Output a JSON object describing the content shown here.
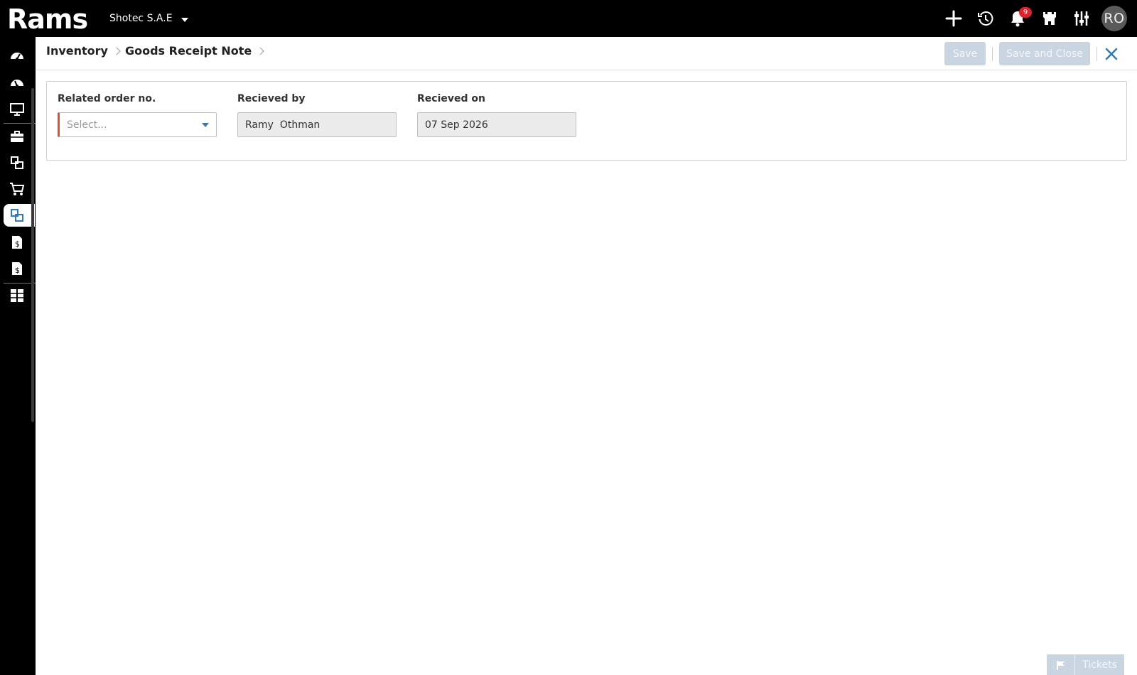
{
  "app": {
    "logo_text": "Rams",
    "company": "Shotec S.A.E"
  },
  "topbar": {
    "icons": [
      "plus-icon",
      "history-icon",
      "bell-icon",
      "castle-icon",
      "sliders-icon"
    ],
    "notification_count": "9",
    "user_initials": "RO"
  },
  "sidebar": {
    "items": [
      {
        "icon": "dashboard-icon"
      },
      {
        "icon": "dashboard-alt-icon"
      },
      {
        "icon": "monitor-icon"
      },
      {
        "icon": "briefcase-icon"
      },
      {
        "icon": "inventory-boxes-icon"
      },
      {
        "icon": "cart-icon"
      },
      {
        "icon": "inventory-active-icon",
        "active": true
      },
      {
        "icon": "invoice-dollar-icon"
      },
      {
        "icon": "invoice-dollar-alt-icon"
      },
      {
        "icon": "reports-grid-icon"
      }
    ]
  },
  "header": {
    "breadcrumb": [
      "Inventory",
      "Goods Receipt Note"
    ],
    "save_label": "Save",
    "save_close_label": "Save and Close"
  },
  "form": {
    "related_order": {
      "label": "Related order no.",
      "placeholder": "Select..."
    },
    "received_by": {
      "label": "Recieved by",
      "value": "Ramy  Othman"
    },
    "received_on": {
      "label": "Recieved on",
      "value": "07 Sep 2026"
    }
  },
  "tickets": {
    "label": "Tickets"
  },
  "colors": {
    "topbar": "#000000",
    "disabled_button": "#c9d5e1",
    "accent_blue": "#2b7bc2",
    "required_red": "#e0502f",
    "badge_red": "#e0202a"
  }
}
